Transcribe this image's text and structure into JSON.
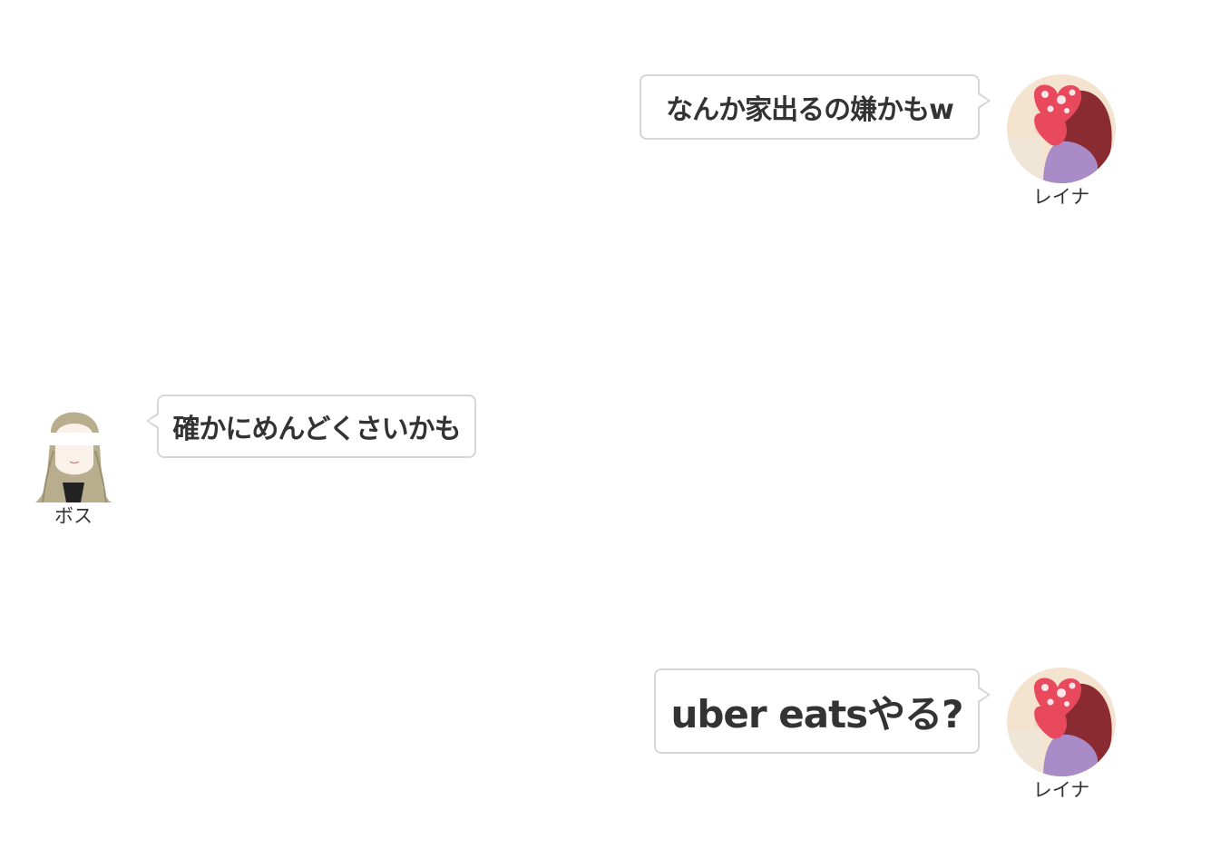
{
  "messages": [
    {
      "speaker": "レイナ",
      "side": "right",
      "text": "なんか家出るの嫌かもw",
      "avatar": "reina-avatar-heart-sticker"
    },
    {
      "speaker": "ボス",
      "side": "left",
      "text": "確かにめんどくさいかも",
      "avatar": "boss-avatar-illustrated-woman"
    },
    {
      "speaker": "レイナ",
      "side": "right",
      "text": "uber eatsやる?",
      "avatar": "reina-avatar-heart-sticker"
    }
  ],
  "colors": {
    "background": "#ffffff",
    "bubble_border": "#d6d6d6",
    "text": "#333333",
    "heart": "#e8495d"
  }
}
